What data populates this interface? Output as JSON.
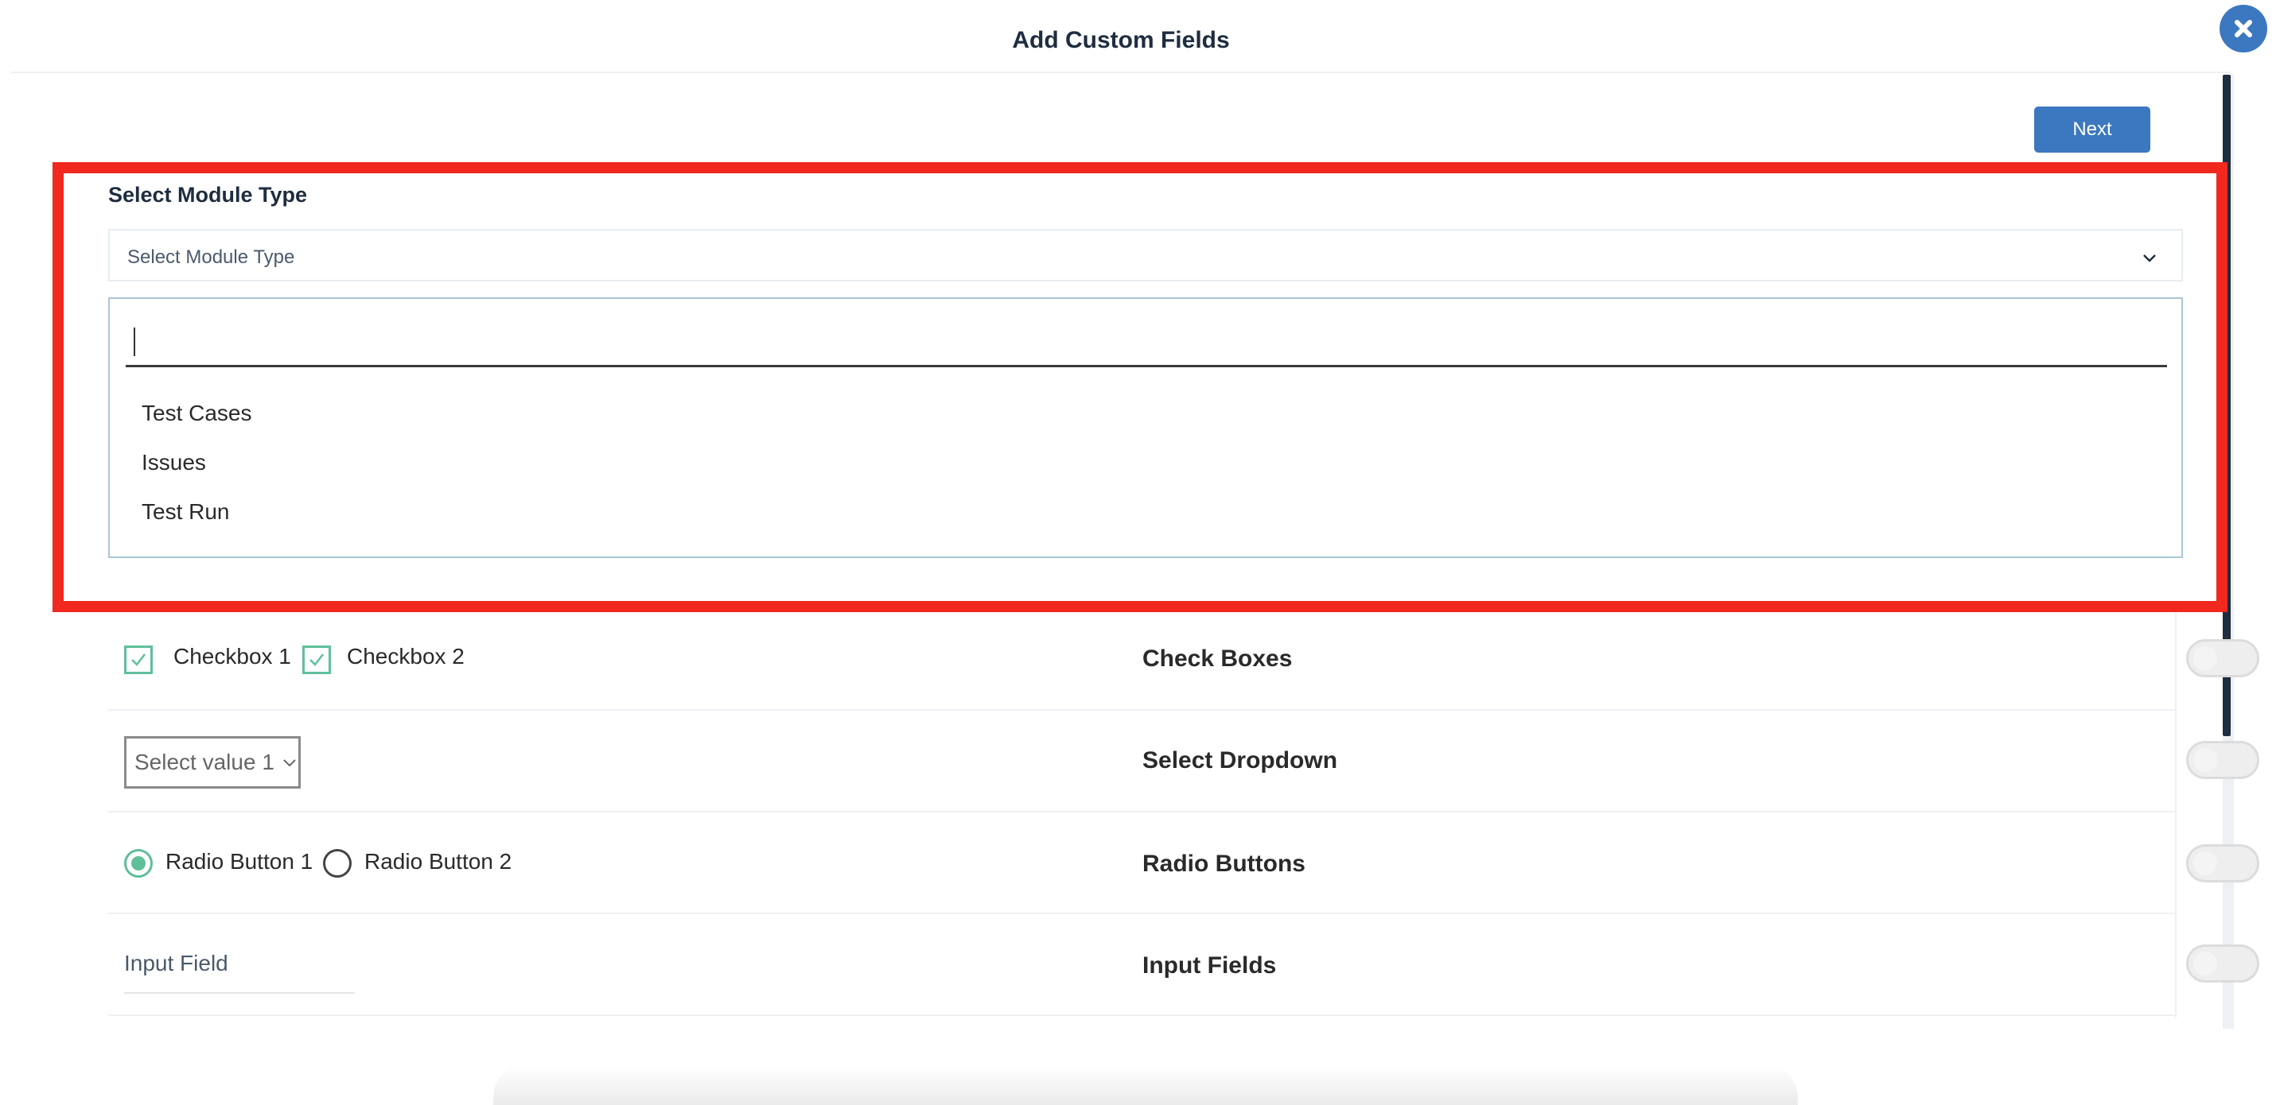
{
  "modal": {
    "title": "Add Custom Fields",
    "next_label": "Next"
  },
  "module_select": {
    "label": "Select Module Type",
    "placeholder": "Select Module Type",
    "search_value": "",
    "options": [
      "Test Cases",
      "Issues",
      "Test Run"
    ]
  },
  "fields": {
    "checkboxes": {
      "name": "Check Boxes",
      "items": [
        "Checkbox 1",
        "Checkbox 2"
      ]
    },
    "select_dropdown": {
      "name": "Select Dropdown",
      "value": "Select value 1"
    },
    "radio_buttons": {
      "name": "Radio Buttons",
      "items": [
        "Radio Button 1",
        "Radio Button 2"
      ]
    },
    "input_fields": {
      "name": "Input Fields",
      "placeholder": "Input Field"
    }
  },
  "colors": {
    "primary": "#3b78c0",
    "highlight": "#f0281e",
    "accent_green": "#5fbf9a",
    "dark": "#1e2d3f"
  }
}
